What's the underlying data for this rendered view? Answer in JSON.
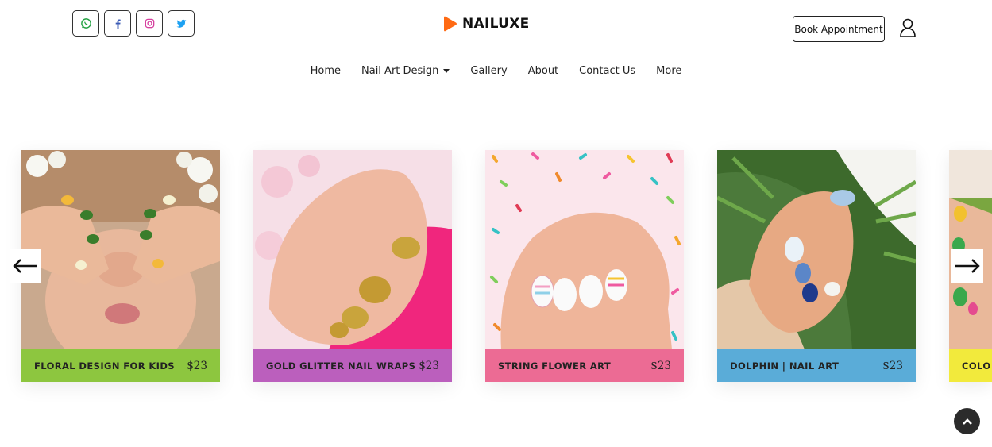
{
  "header": {
    "brand_name": "NAILUXE",
    "brand_color": "#ff6a13",
    "social": [
      {
        "icon": "whatsapp-icon",
        "color": "#25a244"
      },
      {
        "icon": "facebook-icon",
        "color": "#3b5bb5"
      },
      {
        "icon": "instagram-icon",
        "color": "#d6409f"
      },
      {
        "icon": "twitter-icon",
        "color": "#1da1f2"
      }
    ],
    "book_label": "Book Appointment",
    "user_icon": "user-icon"
  },
  "nav": {
    "items": [
      "Home",
      "Nail Art Design",
      "Gallery",
      "About",
      "Contact Us",
      "More"
    ]
  },
  "carousel": {
    "prev_icon": "arrow-left-icon",
    "next_icon": "arrow-right-icon",
    "cards": [
      {
        "title": "FLORAL DESIGN FOR KIDS",
        "price": "$23",
        "color": "#8dc63f"
      },
      {
        "title": "GOLD GLITTER NAIL WRAPS",
        "price": "$23",
        "color": "#bb5fbd"
      },
      {
        "title": "STRING FLOWER ART",
        "price": "$23",
        "color": "#ec6b94"
      },
      {
        "title": "DOLPHIN | NAIL ART",
        "price": "$23",
        "color": "#5aacd8"
      },
      {
        "title": "COLO",
        "price": "",
        "color": "#f2ea3c"
      }
    ]
  },
  "scroll_top_icon": "chevron-up-icon"
}
